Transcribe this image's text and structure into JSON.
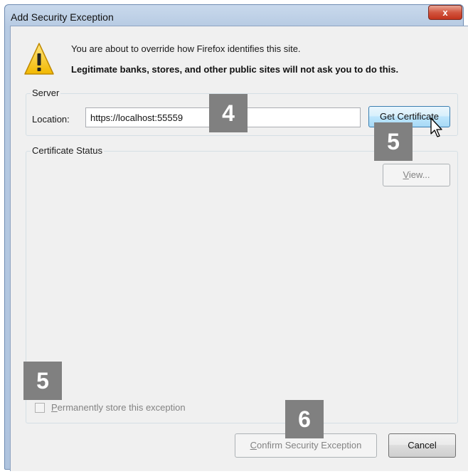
{
  "window": {
    "title": "Add Security Exception",
    "close_glyph": "x"
  },
  "warning": {
    "icon": "warning-icon",
    "message": "You are about to override how Firefox identifies this site.",
    "emphasis": "Legitimate banks, stores, and other public sites will not ask you to do this."
  },
  "server": {
    "group_label": "Server",
    "location_label": "Location:",
    "location_value": "https://localhost:55559",
    "get_certificate_label": "Get Certificate"
  },
  "certificate_status": {
    "group_label": "Certificate Status",
    "view_prefix": "",
    "view_accel": "V",
    "view_rest": "iew...",
    "permanent_accel": "P",
    "permanent_rest": "ermanently store this exception",
    "permanent_checked": false
  },
  "footer": {
    "confirm_accel": "C",
    "confirm_rest": "onfirm Security Exception",
    "cancel_label": "Cancel"
  },
  "annotations": {
    "step_location": "4",
    "step_get_certificate": "5",
    "step_permanent": "5",
    "step_confirm": "6"
  },
  "colors": {
    "accent_blue": "#3c7fb1",
    "badge_gray": "#808080",
    "disabled_text": "#838383"
  }
}
